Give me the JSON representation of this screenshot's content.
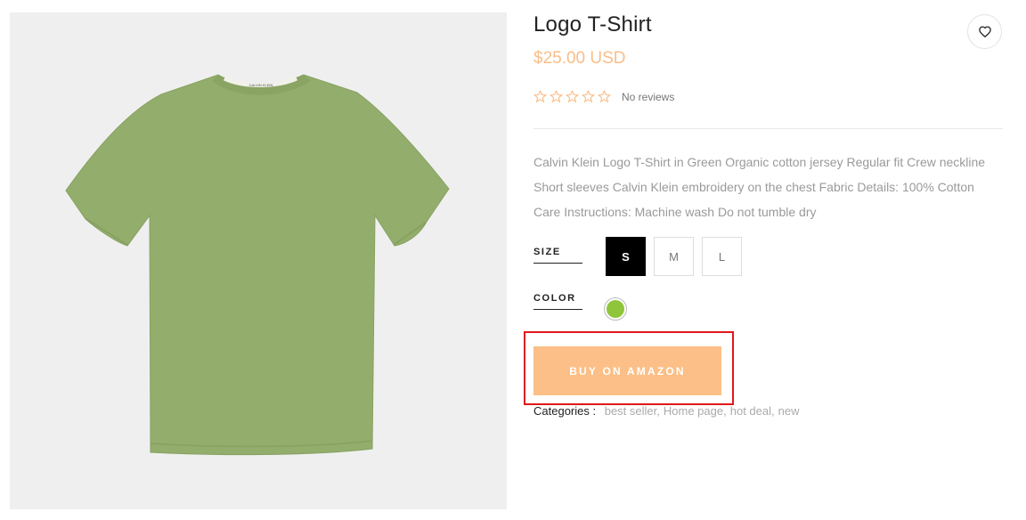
{
  "product": {
    "title": "Logo T-Shirt",
    "price": "$25.00 USD",
    "rating": {
      "value": 0,
      "max": 5,
      "reviews_label": "No reviews"
    },
    "description": "Calvin Klein Logo T-Shirt in Green Organic cotton jersey Regular fit Crew neckline Short sleeves Calvin Klein embroidery on the chest Fabric Details: 100% Cotton Care Instructions: Machine wash Do not tumble dry",
    "image_icon": "t-shirt-image",
    "image_label": "CALVIN KLEIN"
  },
  "wishlist": {
    "icon": "heart-icon"
  },
  "options": {
    "size": {
      "label": "SIZE",
      "choices": [
        "S",
        "M",
        "L"
      ],
      "selected": "S"
    },
    "color": {
      "label": "COLOR",
      "choices": [
        "#8fc53b"
      ],
      "selected": "#8fc53b"
    }
  },
  "buy_button": {
    "label": "BUY ON AMAZON",
    "color": "#fcbf87"
  },
  "categories": {
    "label": "Categories :",
    "items": [
      "best seller",
      "Home page",
      "hot deal",
      "new"
    ]
  },
  "colors": {
    "accent": "#fbbd88",
    "highlight": "#e0181b",
    "shirt": "#93ae6c"
  }
}
